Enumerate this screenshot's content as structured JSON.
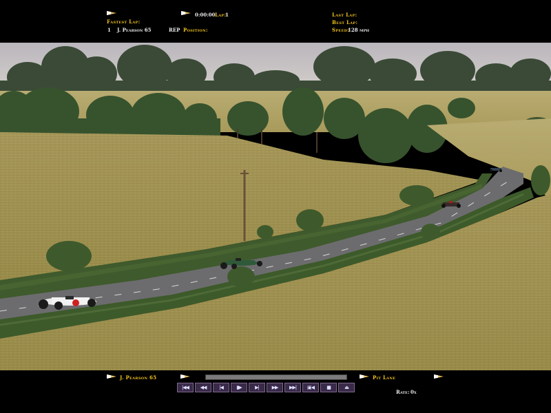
{
  "top_hud": {
    "fastest_lap_label": "Fastest Lap:",
    "fastest_pos": "1",
    "fastest_driver": "J. Pearson 65",
    "rep_label": "REP",
    "position_label": "Position:",
    "position_value": "",
    "race_time": "0:00:00",
    "lap_label": "Lap:",
    "lap_value": "1",
    "last_lap_label": "Last Lap:",
    "best_lap_label": "Best Lap:",
    "speed_label": "Speed:",
    "speed_value": "128 mph"
  },
  "bottom_hud": {
    "driver": "J. Pearson 65",
    "pit_lane": "Pit Lane",
    "rate_label": "Rate:",
    "rate_value": "0x",
    "replay_progress": 0.0
  },
  "controls": [
    {
      "name": "skip-to-start-button",
      "glyph": "|◀◀"
    },
    {
      "name": "fast-rewind-button",
      "glyph": "◀◀"
    },
    {
      "name": "rewind-button",
      "glyph": "|◀"
    },
    {
      "name": "pause-button",
      "glyph": "▮▶"
    },
    {
      "name": "play-button",
      "glyph": "▶|"
    },
    {
      "name": "fast-forward-button",
      "glyph": "▶▶"
    },
    {
      "name": "skip-to-end-button",
      "glyph": "▶▶|"
    },
    {
      "name": "camera-button",
      "glyph": "▣◀"
    },
    {
      "name": "stop-button",
      "glyph": "■"
    },
    {
      "name": "exit-button",
      "glyph": "⏏"
    }
  ],
  "colors": {
    "label": "#f0c21a",
    "value": "#ececec",
    "sky": "#c9c5c9",
    "grass": "#a99a52",
    "hedge": "#3f5a2c",
    "road": "#6a6a6a"
  }
}
